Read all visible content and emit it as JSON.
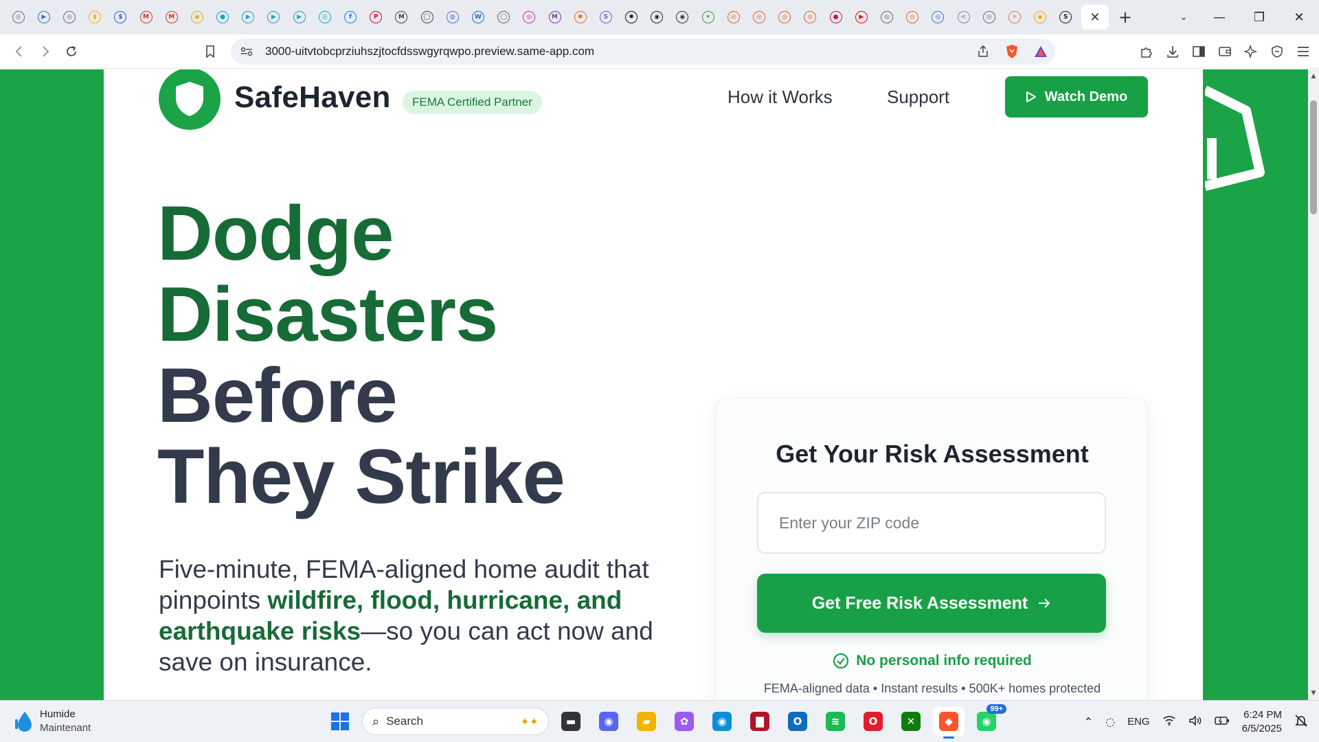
{
  "browser": {
    "tabs": [
      {
        "icon": "generic-site-icon",
        "glyph": "◎",
        "color": "#5f6b7a"
      },
      {
        "icon": "play-icon",
        "glyph": "▶",
        "color": "#3b6fd8"
      },
      {
        "icon": "generic-site-icon",
        "glyph": "◎",
        "color": "#5f6b7a"
      },
      {
        "icon": "keep-icon",
        "glyph": "▮",
        "color": "#f4b400"
      },
      {
        "icon": "dollar-icon",
        "glyph": "$",
        "color": "#2a62c9"
      },
      {
        "icon": "gmail-icon",
        "glyph": "M",
        "color": "#d93025"
      },
      {
        "icon": "gmail-icon",
        "glyph": "M",
        "color": "#d93025"
      },
      {
        "icon": "chrome-icon",
        "glyph": "◉",
        "color": "#f2a600"
      },
      {
        "icon": "circle-icon",
        "glyph": "●",
        "color": "#0aa6c9"
      },
      {
        "icon": "play-icon",
        "glyph": "▶",
        "color": "#18a3c9"
      },
      {
        "icon": "play-icon",
        "glyph": "▶",
        "color": "#18a3c9"
      },
      {
        "icon": "play-icon",
        "glyph": "▶",
        "color": "#18a3c9"
      },
      {
        "icon": "circle-icon",
        "glyph": "◎",
        "color": "#18a3c9"
      },
      {
        "icon": "facebook-icon",
        "glyph": "f",
        "color": "#1877f2"
      },
      {
        "icon": "pinterest-icon",
        "glyph": "P",
        "color": "#e60023"
      },
      {
        "icon": "ms-icon",
        "glyph": "M",
        "color": "#444"
      },
      {
        "icon": "circle-icon",
        "glyph": "◯",
        "color": "#444"
      },
      {
        "icon": "chat-icon",
        "glyph": "◍",
        "color": "#5b6bd6"
      },
      {
        "icon": "word-icon",
        "glyph": "W",
        "color": "#2b63c6"
      },
      {
        "icon": "ring-icon",
        "glyph": "◯",
        "color": "#666"
      },
      {
        "icon": "instagram-icon",
        "glyph": "◎",
        "color": "#d6249f"
      },
      {
        "icon": "letter-m-icon",
        "glyph": "M",
        "color": "#6b3fa0"
      },
      {
        "icon": "slack-like-icon",
        "glyph": "✱",
        "color": "#e06b1c"
      },
      {
        "icon": "letter-s-icon",
        "glyph": "S",
        "color": "#6b5bd6"
      },
      {
        "icon": "openai-icon",
        "glyph": "✺",
        "color": "#111"
      },
      {
        "icon": "circle-icon",
        "glyph": "◉",
        "color": "#222"
      },
      {
        "icon": "github-icon",
        "glyph": "◉",
        "color": "#333"
      },
      {
        "icon": "star-icon",
        "glyph": "✶",
        "color": "#3a9a3a"
      },
      {
        "icon": "circle-icon",
        "glyph": "◎",
        "color": "#e5602a"
      },
      {
        "icon": "circle-icon",
        "glyph": "◎",
        "color": "#e5602a"
      },
      {
        "icon": "circle-icon",
        "glyph": "◎",
        "color": "#e5602a"
      },
      {
        "icon": "circle-icon",
        "glyph": "◎",
        "color": "#e5602a"
      },
      {
        "icon": "circle-icon",
        "glyph": "●",
        "color": "#d4153b"
      },
      {
        "icon": "youtube-icon",
        "glyph": "▶",
        "color": "#ff0000"
      },
      {
        "icon": "circle-icon",
        "glyph": "◎",
        "color": "#666"
      },
      {
        "icon": "circle-icon",
        "glyph": "◎",
        "color": "#e5602a"
      },
      {
        "icon": "circle-icon",
        "glyph": "◎",
        "color": "#3a6fd6"
      },
      {
        "icon": "share-icon",
        "glyph": "<",
        "color": "#7a8aa0"
      },
      {
        "icon": "generic-site-icon",
        "glyph": "◎",
        "color": "#5f6b7a"
      },
      {
        "icon": "claude-icon",
        "glyph": "✳",
        "color": "#d97757"
      },
      {
        "icon": "chrome-icon",
        "glyph": "◉",
        "color": "#f2a600"
      },
      {
        "icon": "letter-s-icon",
        "glyph": "S",
        "color": "#222"
      }
    ],
    "active_tab_close": "✕",
    "new_tab": "+",
    "tab_search": "⌄",
    "window_controls": {
      "minimize": "—",
      "maximize": "❐",
      "close": "✕"
    },
    "url": "3000-uitvtobcprziuhszjtocfdsswgyrqwpo.preview.same-app.com"
  },
  "page": {
    "brand": "SafeHaven",
    "badge": "FEMA Certified Partner",
    "nav": {
      "how_it_works": "How it Works",
      "support": "Support"
    },
    "cta_demo": "Watch Demo",
    "hero": {
      "line1": "Dodge",
      "line2": "Disasters",
      "line3": "Before",
      "line4": "They Strike",
      "sub_pre": "Five-minute, FEMA-aligned home audit that pinpoints ",
      "sub_hl": "wildfire, flood, hurricane, and earthquake risks",
      "sub_post": "—so you can act now and save on insurance."
    },
    "risk": {
      "title": "Get Your Risk Assessment",
      "zip_placeholder": "Enter your ZIP code",
      "button": "Get Free Risk Assessment",
      "no_info": "No personal info required",
      "fine": "FEMA-aligned data • Instant results • 500K+ homes protected"
    },
    "colors": {
      "brand_green": "#18a046",
      "dark_green": "#176b36",
      "dark_text": "#323a4b"
    }
  },
  "taskbar": {
    "weather_title": "Humide",
    "weather_sub": "Maintenant",
    "search": "Search",
    "apps": [
      {
        "name": "windows-start",
        "glyph": "⊞",
        "color": "#1a73e8"
      },
      {
        "name": "file-explorer",
        "glyph": "▬",
        "color": "#333"
      },
      {
        "name": "discord",
        "glyph": "◉",
        "color": "#5865f2"
      },
      {
        "name": "folder",
        "glyph": "▰",
        "color": "#f2b400"
      },
      {
        "name": "copilot",
        "glyph": "✿",
        "color": "#9a5cf0"
      },
      {
        "name": "edge",
        "glyph": "◉",
        "color": "#0f8ed8"
      },
      {
        "name": "app-red",
        "glyph": "▇",
        "color": "#b3132a"
      },
      {
        "name": "outlook",
        "glyph": "O",
        "color": "#0f6cbd"
      },
      {
        "name": "spotify",
        "glyph": "≋",
        "color": "#1db954"
      },
      {
        "name": "opera",
        "glyph": "O",
        "color": "#e11d2b"
      },
      {
        "name": "xbox",
        "glyph": "✕",
        "color": "#107c10"
      },
      {
        "name": "brave",
        "glyph": "◆",
        "color": "#fb542b"
      },
      {
        "name": "whatsapp",
        "glyph": "◉",
        "color": "#25d366"
      }
    ],
    "whatsapp_badge": "99+",
    "lang": "ENG",
    "time": "6:24 PM",
    "date": "6/5/2025"
  }
}
